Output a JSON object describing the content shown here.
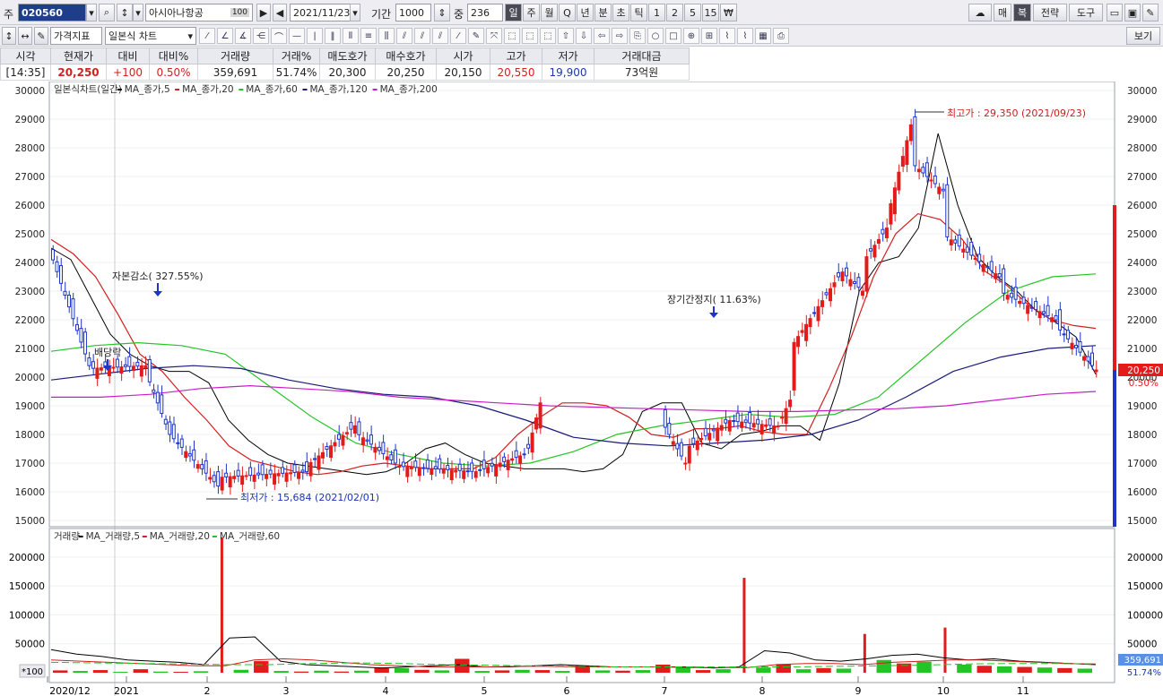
{
  "toolbar": {
    "code_label": "주",
    "stock_code": "020560",
    "stock_name": "아시아나항공",
    "name_badge": "100",
    "date": "2021/11/23",
    "period_label": "기간",
    "period_value": "1000",
    "count_label": "중",
    "count_value": "236",
    "timeframes": [
      "일",
      "주",
      "월",
      "Q",
      "년",
      "분",
      "초",
      "틱",
      "1",
      "2",
      "5",
      "15",
      "₩"
    ],
    "right_buttons": [
      "매",
      "복",
      "전략",
      "도구"
    ]
  },
  "toolbar2": {
    "indicator_dropdown": "가격지표",
    "chart_type_dropdown": "일본식 차트",
    "view_button": "보기"
  },
  "quote": {
    "headers": [
      "시각",
      "현재가",
      "대비",
      "대비%",
      "거래량",
      "거래%",
      "매도호가",
      "매수호가",
      "시가",
      "고가",
      "저가",
      "거래대금"
    ],
    "values": [
      "[14:35]",
      "20,250",
      "+100",
      "0.50%",
      "359,691",
      "51.74%",
      "20,300",
      "20,250",
      "20,150",
      "20,550",
      "19,900",
      "73억원"
    ]
  },
  "legend": {
    "price": "일본식차트(일간)",
    "price_ma": [
      "MA_종가,5",
      "MA_종가,20",
      "MA_종가,60",
      "MA_종가,120",
      "MA_종가,200"
    ],
    "volume": "거래량",
    "volume_ma": [
      "MA_거래량,5",
      "MA_거래량,20",
      "MA_거래량,60"
    ]
  },
  "annotations": {
    "capital_reduction": "자본감소( 327.55%)",
    "dividend": "배당락",
    "halt": "장기간정지( 11.63%)",
    "high": "최고가 : 29,350 (2021/09/23)",
    "low": "최저가 : 15,684 (2021/02/01)"
  },
  "price_tag": {
    "price": "20,250",
    "change": "0.50%"
  },
  "volume_tag": {
    "volume": "359,691",
    "ratio": "51.74%"
  },
  "volume_unit": "*100",
  "colors": {
    "up": "#e21b1b",
    "down": "#1d35c8",
    "ma5": "#000000",
    "ma20": "#d21f1f",
    "ma60": "#24c424",
    "ma120": "#1a1a7a",
    "ma200": "#c81ec8"
  },
  "chart_data": {
    "type": "candlestick",
    "price_axis": {
      "ylim": [
        15000,
        30000
      ],
      "ticks": [
        15000,
        16000,
        17000,
        18000,
        19000,
        20000,
        21000,
        22000,
        23000,
        24000,
        25000,
        26000,
        27000,
        28000,
        29000,
        30000
      ]
    },
    "volume_axis": {
      "ylim": [
        0,
        240000
      ],
      "ticks": [
        50000,
        100000,
        150000,
        200000
      ]
    },
    "x_labels": [
      "2020/12",
      "2021",
      "2",
      "3",
      "4",
      "5",
      "6",
      "7",
      "8",
      "9",
      "10",
      "11"
    ],
    "series": [
      {
        "name": "MA_종가,5",
        "values": [
          24500,
          24100,
          22800,
          21500,
          20800,
          20400,
          20200,
          20200,
          19800,
          18500,
          17800,
          17300,
          17000,
          16900,
          16800,
          16700,
          16600,
          16700,
          17000,
          17500,
          17700,
          17300,
          17000,
          16900,
          16800,
          16800,
          16800,
          16700,
          16800,
          17300,
          18800,
          19100,
          19100,
          17700,
          17500,
          18000,
          18100,
          18300,
          18300,
          17800,
          19800,
          23000,
          24000,
          24200,
          25200,
          28500,
          26000,
          24200,
          23500,
          23000,
          22300,
          21900,
          21400,
          20100
        ]
      },
      {
        "name": "MA_종가,20",
        "values": [
          24800,
          24300,
          23500,
          22200,
          20800,
          20200,
          19300,
          18500,
          17600,
          17100,
          16900,
          16700,
          16600,
          16700,
          16900,
          17000,
          16900,
          16800,
          16800,
          16800,
          17200,
          18000,
          18600,
          19100,
          19100,
          19000,
          18600,
          18000,
          17900,
          18200,
          18200,
          18300,
          18100,
          18000,
          18000,
          19600,
          21400,
          23500,
          25000,
          25700,
          25500,
          24800,
          23700,
          23200,
          22500,
          22000,
          21800,
          21700
        ]
      },
      {
        "name": "MA_종가,60",
        "values": [
          20900,
          21100,
          21200,
          21100,
          20800,
          19700,
          18600,
          17700,
          17300,
          17000,
          16900,
          17000,
          17400,
          18000,
          18300,
          18500,
          18700,
          18600,
          18700,
          19300,
          20600,
          21900,
          23000,
          23500,
          23600
        ]
      },
      {
        "name": "MA_종가,120",
        "values": [
          19900,
          20100,
          20300,
          20400,
          20300,
          19900,
          19600,
          19400,
          19300,
          19000,
          18500,
          17900,
          17700,
          17600,
          17700,
          17800,
          18000,
          18500,
          19300,
          20200,
          20700,
          21000,
          21100
        ]
      },
      {
        "name": "MA_종가,200",
        "values": [
          19300,
          19300,
          19400,
          19600,
          19700,
          19600,
          19500,
          19300,
          19200,
          19100,
          19000,
          18950,
          18900,
          18850,
          18800,
          18800,
          18850,
          18900,
          19000,
          19200,
          19400,
          19500
        ]
      }
    ],
    "volume_values": [
      4000,
      3000,
      4500,
      1500,
      6000,
      2000,
      1500,
      2500,
      234000,
      5000,
      20000,
      3000,
      2000,
      3500,
      2000,
      3500,
      9000,
      8000,
      5000,
      4000,
      24000,
      3000,
      4000,
      5000,
      4500,
      3000,
      12000,
      4000,
      3500,
      4500,
      14000,
      11000,
      4500,
      6000,
      164000,
      9000,
      15000,
      6000,
      8000,
      7000,
      67000,
      22000,
      16000,
      19000,
      78000,
      14000,
      12000,
      11000,
      10000,
      9000,
      8000,
      7000
    ]
  }
}
